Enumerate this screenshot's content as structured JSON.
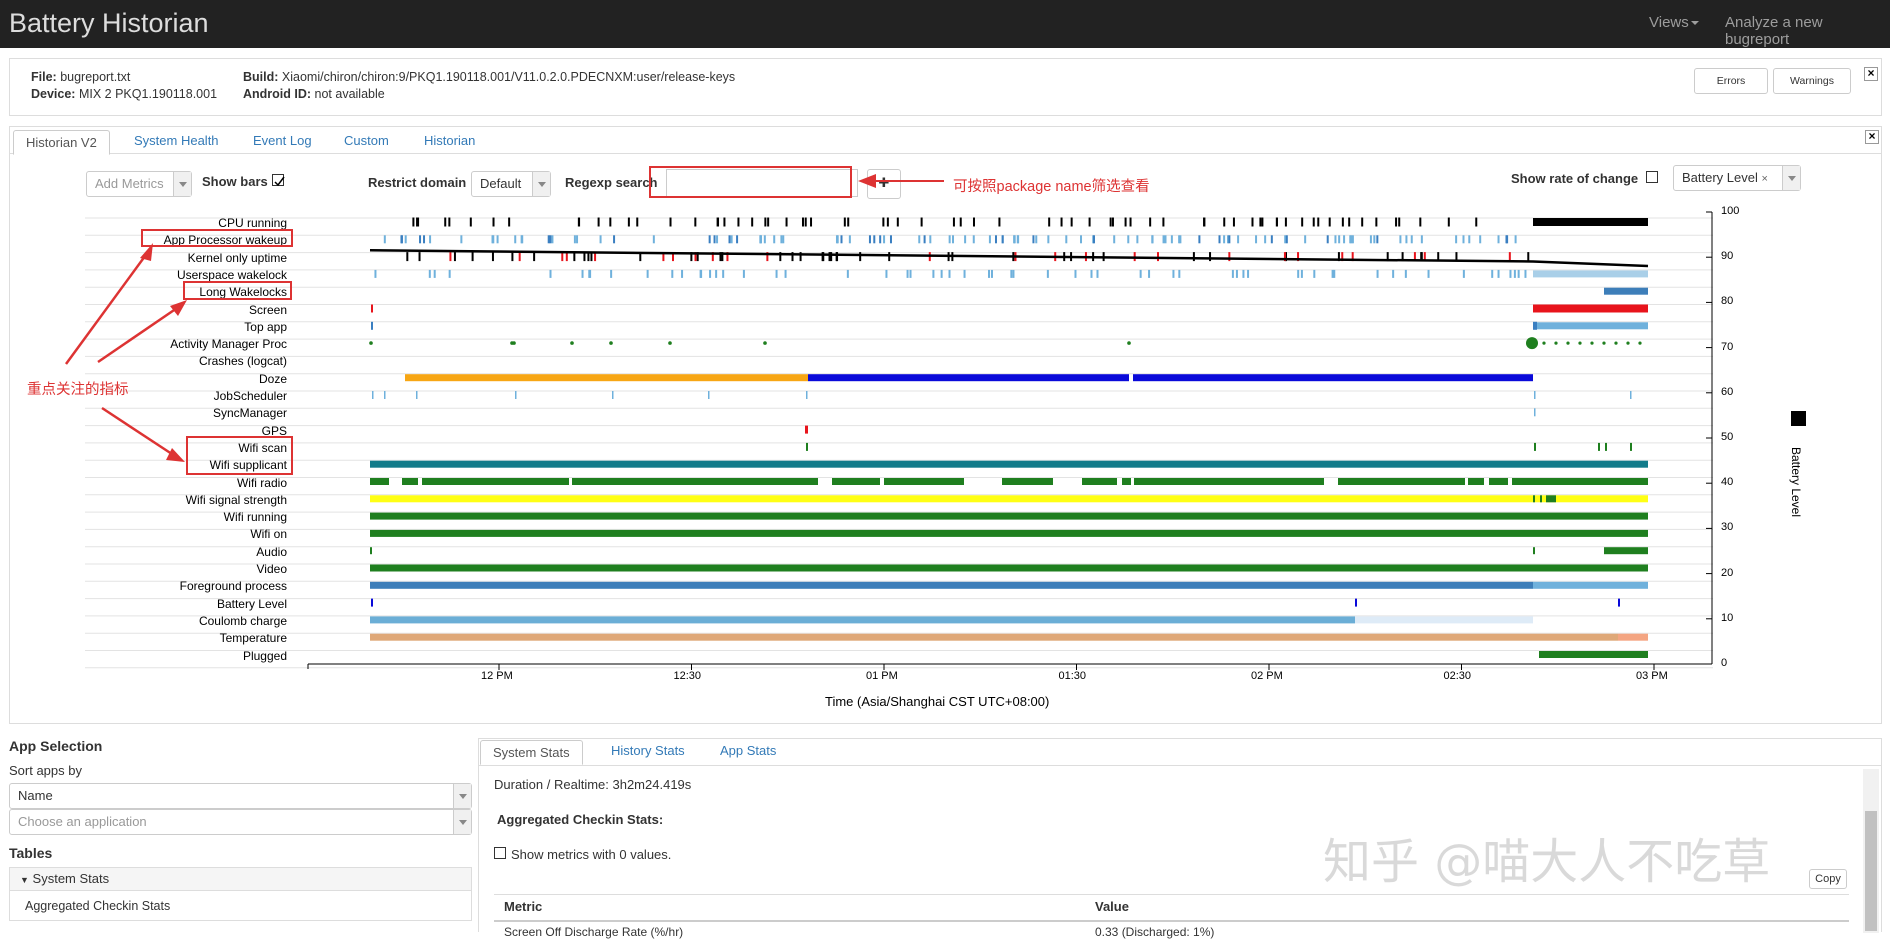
{
  "app": {
    "title": "Battery Historian"
  },
  "nav": {
    "views": "Views",
    "analyze": "Analyze a new bugreport"
  },
  "file_info": {
    "file_label": "File:",
    "file_value": "bugreport.txt",
    "device_label": "Device:",
    "device_value": "MIX 2 PKQ1.190118.001",
    "build_label": "Build:",
    "build_value": "Xiaomi/chiron/chiron:9/PKQ1.190118.001/V11.0.2.0.PDECNXM:user/release-keys",
    "android_id_label": "Android ID:",
    "android_id_value": "not available",
    "errors_button": "Errors",
    "warnings_button": "Warnings"
  },
  "tabs": [
    "Historian V2",
    "System Health",
    "Event Log",
    "Custom",
    "Historian"
  ],
  "controls": {
    "add_metrics": "Add Metrics",
    "show_bars": "Show bars",
    "show_bars_checked": true,
    "restrict_domain": "Restrict domain",
    "restrict_domain_value": "Default",
    "regexp_search": "Regexp search",
    "regexp_value": "",
    "show_rate_of_change": "Show rate of change",
    "battery_level_select": "Battery Level"
  },
  "annotations": {
    "filter_hint": "可按照package name筛选查看",
    "focus_hint": "重点关注的指标"
  },
  "rows": [
    "CPU running",
    "App Processor wakeup",
    "Kernel only uptime",
    "Userspace wakelock",
    "Long Wakelocks",
    "Screen",
    "Top app",
    "Activity Manager Proc",
    "Crashes (logcat)",
    "Doze",
    "JobScheduler",
    "SyncManager",
    "GPS",
    "Wifi scan",
    "Wifi supplicant",
    "Wifi radio",
    "Wifi signal strength",
    "Wifi running",
    "Wifi on",
    "Audio",
    "Video",
    "Foreground process",
    "Battery Level",
    "Coulomb charge",
    "Temperature",
    "Plugged"
  ],
  "highlighted_rows": [
    "App Processor wakeup",
    "Long Wakelocks",
    "Wifi scan",
    "Wifi supplicant"
  ],
  "x_axis": {
    "ticks": [
      "12 PM",
      "12:30",
      "01 PM",
      "01:30",
      "02 PM",
      "02:30",
      "03 PM"
    ],
    "title": "Time (Asia/Shanghai CST UTC+08:00)"
  },
  "y_axis": {
    "ticks": [
      "100",
      "90",
      "80",
      "70",
      "60",
      "50",
      "40",
      "30",
      "20",
      "10",
      "0"
    ],
    "title": "Battery Level"
  },
  "colors": {
    "black": "#000000",
    "red": "#e8141c",
    "lightblue": "#6fb1dc",
    "blue": "#3a7fc1",
    "steelblue": "#3d7eb9",
    "green": "#1f7f1f",
    "orange": "#f7a614",
    "darkblue": "#0a0ad9",
    "teal": "#127b8a",
    "yellow": "#ffff14",
    "tan": "#dfa878",
    "annot_red": "#d33333"
  },
  "app_selection": {
    "title": "App Selection",
    "sort_label": "Sort apps by",
    "sort_value": "Name",
    "choose_placeholder": "Choose an application",
    "tables_title": "Tables",
    "system_stats": "System Stats",
    "aggregated_item": "Aggregated Checkin Stats"
  },
  "stats": {
    "tabs": [
      "System Stats",
      "History Stats",
      "App Stats"
    ],
    "duration": "Duration / Realtime: 3h2m24.419s",
    "aggregated_title": "Aggregated Checkin Stats:",
    "show_zero": "Show metrics with 0 values.",
    "copy_button": "Copy",
    "col_metric": "Metric",
    "col_value": "Value",
    "first_row_metric": "Screen Off Discharge Rate (%/hr)",
    "first_row_value": "0.33 (Discharged: 1%)"
  },
  "watermark": "知乎 @喵大人不吃草"
}
